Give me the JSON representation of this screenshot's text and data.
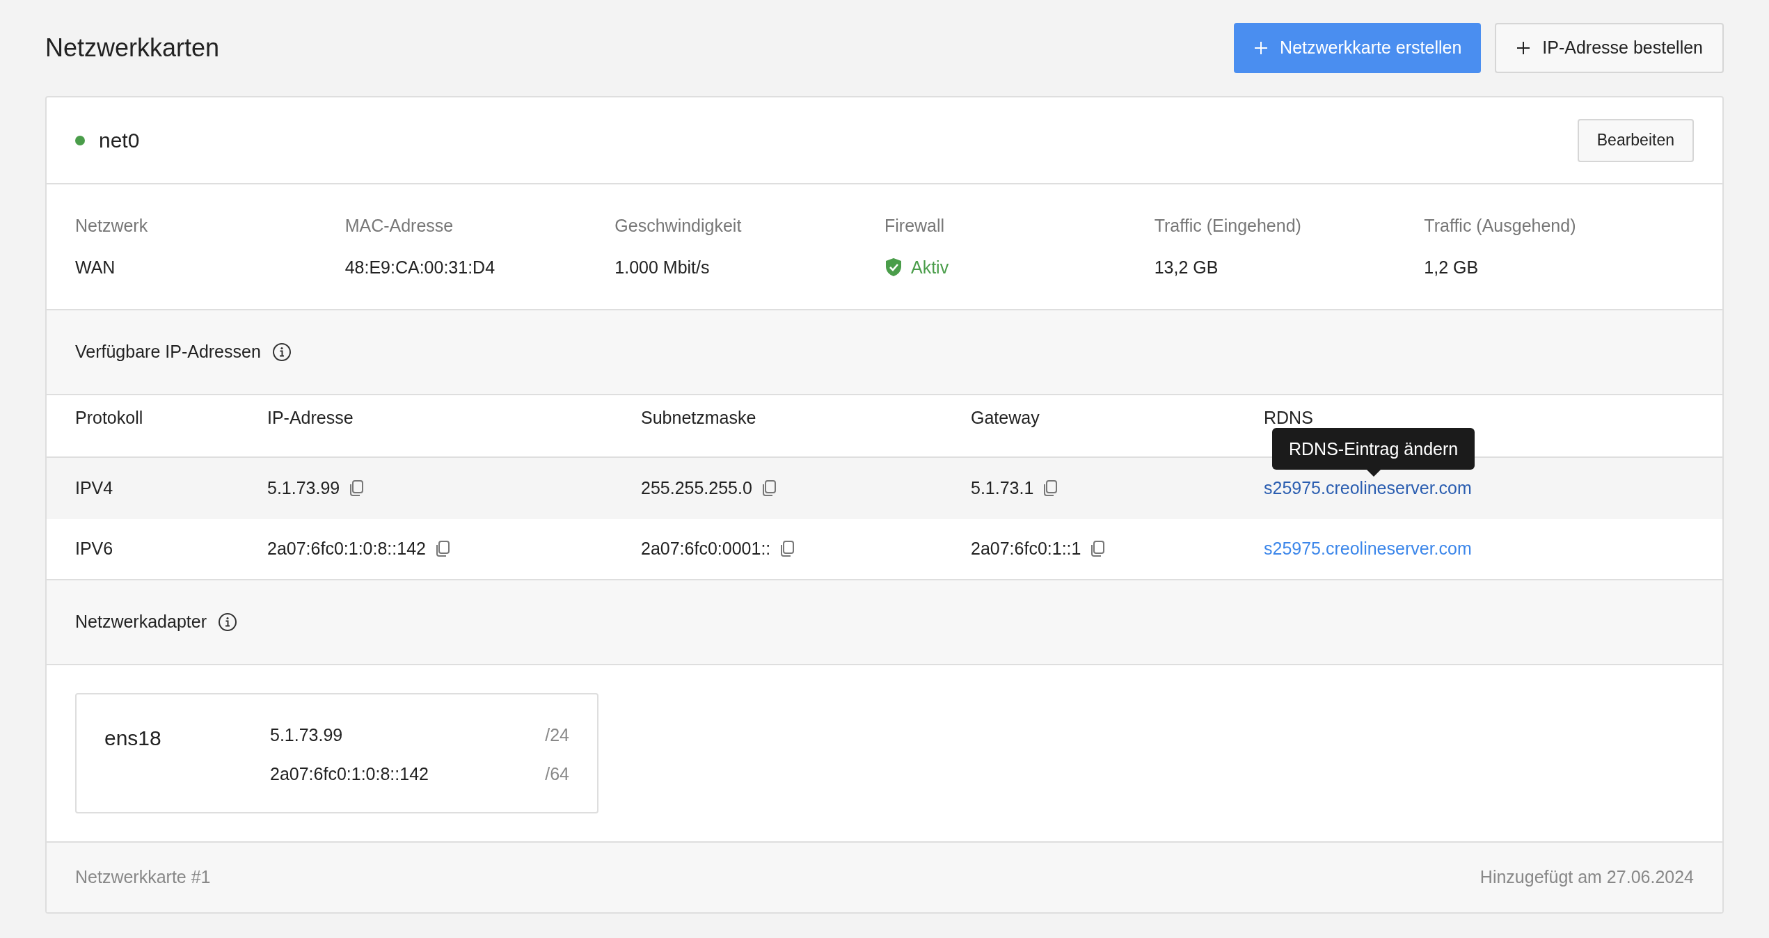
{
  "title": "Netzwerkkarten",
  "buttons": [
    {
      "label": "Netzwerkkarte erstellen",
      "kind": "primary"
    },
    {
      "label": "IP-Adresse bestellen",
      "kind": "secondary"
    }
  ],
  "card": {
    "name": "net0",
    "online": true,
    "edit_button": "Bearbeiten",
    "info": [
      {
        "label": "Netzwerk",
        "value": "WAN",
        "kind": "text"
      },
      {
        "label": "MAC-Adresse",
        "value": "48:E9:CA:00:31:D4",
        "kind": "text"
      },
      {
        "label": "Geschwindigkeit",
        "value": "1.000 Mbit/s",
        "kind": "text"
      },
      {
        "label": "Firewall",
        "value": "Aktiv",
        "kind": "status",
        "active": true
      },
      {
        "label": "Traffic (Eingehend)",
        "value": "13,2 GB",
        "kind": "text"
      },
      {
        "label": "Traffic (Ausgehend)",
        "value": "1,2 GB",
        "kind": "text"
      }
    ],
    "ip_section_title": "Verfügbare IP-Adressen",
    "ip_table": {
      "columns": [
        "Protokoll",
        "IP-Adresse",
        "Subnetzmaske",
        "Gateway",
        "RDNS"
      ],
      "rows": [
        {
          "protocol": "IPV4",
          "ip": "5.1.73.99",
          "subnet": "255.255.255.0",
          "gateway": "5.1.73.1",
          "rdns": "s25975.creolineserver.com",
          "hovered": true,
          "tooltip": "RDNS-Eintrag ändern"
        },
        {
          "protocol": "IPV6",
          "ip": "2a07:6fc0:1:0:8::142",
          "subnet": "2a07:6fc0:0001::",
          "gateway": "2a07:6fc0:1::1",
          "rdns": "s25975.creolineserver.com",
          "hovered": false
        }
      ]
    },
    "adapter_section_title": "Netzwerkadapter",
    "adapters": [
      {
        "name": "ens18",
        "addresses": [
          {
            "ip": "5.1.73.99",
            "prefix": "/24"
          },
          {
            "ip": "2a07:6fc0:1:0:8::142",
            "prefix": "/64"
          }
        ]
      }
    ],
    "footer_left": "Netzwerkkarte #1",
    "footer_right": "Hinzugefügt am 27.06.2024"
  }
}
